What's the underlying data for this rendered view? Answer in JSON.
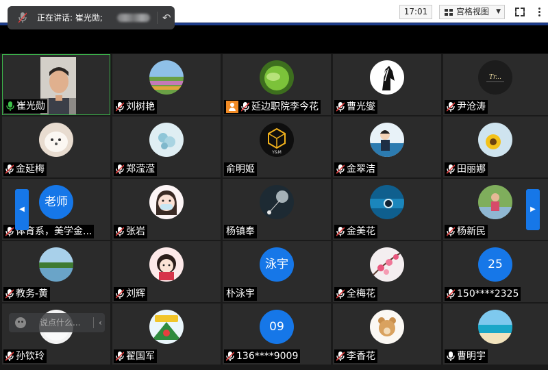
{
  "toolbar": {
    "time": "17:01",
    "view_label": "宫格视图",
    "view_caret": "▼"
  },
  "speaking": {
    "label": "正在讲话: 崔光勋;",
    "back_glyph": "↶"
  },
  "chat": {
    "placeholder": "说点什么...",
    "collapse_glyph": "‹"
  },
  "nav": {
    "prev_glyph": "◀",
    "next_glyph": "▶"
  },
  "participants": [
    {
      "name": "崔光勋",
      "mic": "on",
      "avatar": "video"
    },
    {
      "name": "刘树艳",
      "mic": "muted",
      "avatar": "field"
    },
    {
      "name": "延边职院李今花",
      "mic": "muted",
      "badge": "host",
      "avatar": "leaf"
    },
    {
      "name": "曹光燮",
      "mic": "muted",
      "avatar": "horse"
    },
    {
      "name": "尹沧涛",
      "mic": "muted",
      "avatar": "dark-logo"
    },
    {
      "name": "金延梅",
      "mic": "muted",
      "avatar": "dog"
    },
    {
      "name": "郑滢滢",
      "mic": "muted",
      "avatar": "flowers-blue"
    },
    {
      "name": "俞明姬",
      "mic": "none",
      "avatar": "cube-logo"
    },
    {
      "name": "金翠洁",
      "mic": "muted",
      "avatar": "cartoon-man"
    },
    {
      "name": "田丽娜",
      "mic": "muted",
      "avatar": "sunflower"
    },
    {
      "name": "体育系，美学金...",
      "mic": "muted",
      "avatar_text": "老师"
    },
    {
      "name": "张岩",
      "mic": "muted",
      "avatar": "cartoon-girl"
    },
    {
      "name": "杨镇奉",
      "mic": "none",
      "avatar": "dandelion"
    },
    {
      "name": "金美花",
      "mic": "muted",
      "avatar": "blue-lens"
    },
    {
      "name": "杨新民",
      "mic": "muted",
      "avatar": "child"
    },
    {
      "name": "教务-黄",
      "mic": "muted",
      "avatar": "lake"
    },
    {
      "name": "刘辉",
      "mic": "muted",
      "avatar": "anime-girl"
    },
    {
      "name": "朴泳宇",
      "mic": "none",
      "avatar_text": "泳宇"
    },
    {
      "name": "全梅花",
      "mic": "muted",
      "avatar": "plum-blossom"
    },
    {
      "name": "150****2325",
      "mic": "muted",
      "avatar_text": "25"
    },
    {
      "name": "孙钦玲",
      "mic": "muted",
      "avatar": "white"
    },
    {
      "name": "翟国军",
      "mic": "muted",
      "avatar": "badge-logo"
    },
    {
      "name": "136****9009",
      "mic": "muted",
      "avatar_text": "09"
    },
    {
      "name": "李香花",
      "mic": "muted",
      "avatar": "bear"
    },
    {
      "name": "曹明宇",
      "mic": "on-white",
      "avatar": "beach"
    }
  ]
}
